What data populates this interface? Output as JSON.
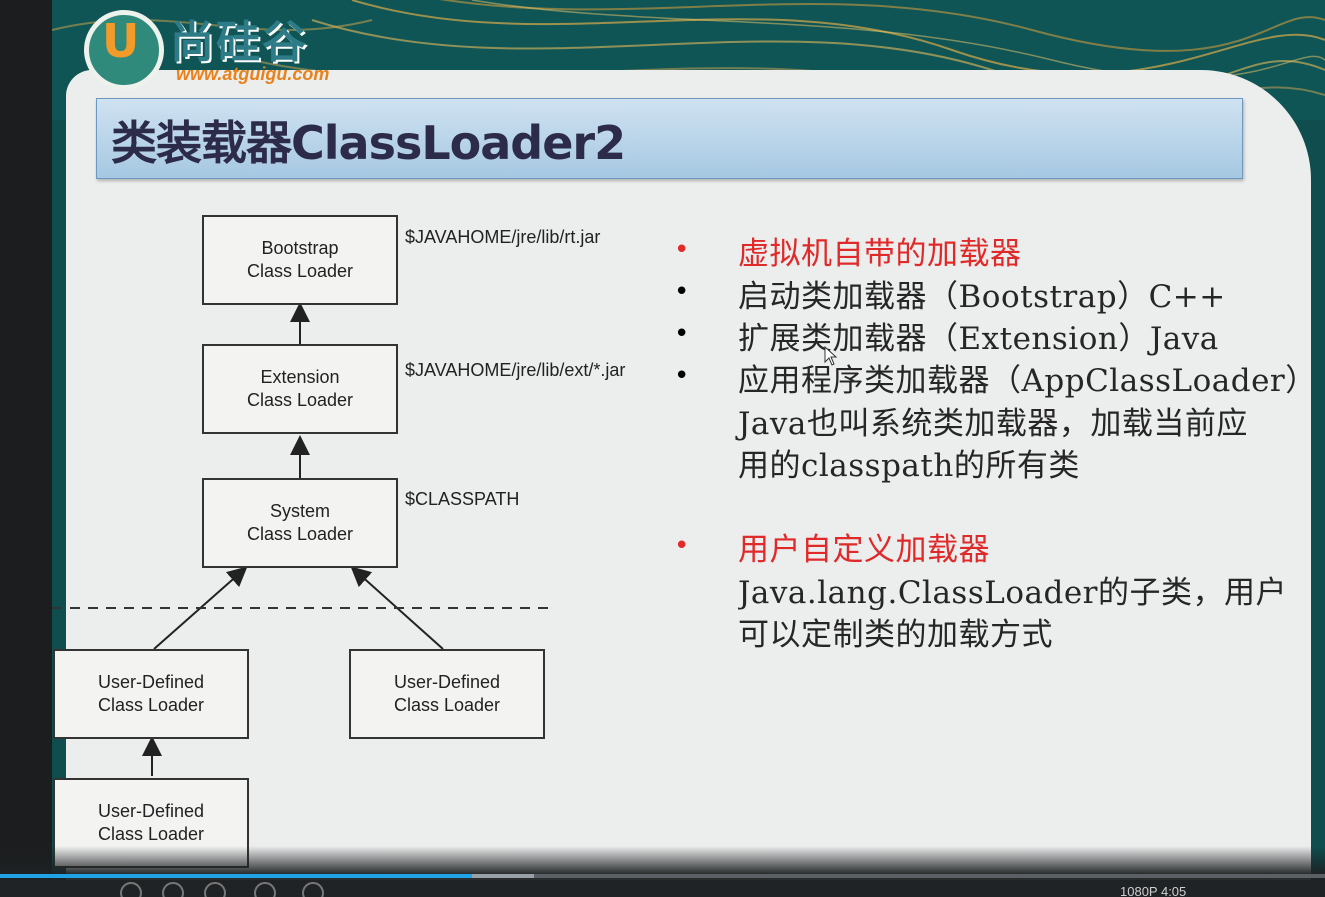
{
  "slide": {
    "logo": {
      "letter": "U",
      "brand": "尚硅谷",
      "url": "www.atguigu.com"
    },
    "title": "类装载器ClassLoader2"
  },
  "diagram": {
    "boxes": [
      {
        "id": "bootstrap",
        "lines": [
          "Bootstrap",
          "Class Loader"
        ]
      },
      {
        "id": "extension",
        "lines": [
          "Extension",
          "Class Loader"
        ]
      },
      {
        "id": "system",
        "lines": [
          "System",
          "Class Loader"
        ]
      },
      {
        "id": "user1",
        "lines": [
          "User-Defined",
          "Class Loader"
        ]
      },
      {
        "id": "user2",
        "lines": [
          "User-Defined",
          "Class Loader"
        ]
      },
      {
        "id": "user3",
        "lines": [
          "User-Defined",
          "Class Loader"
        ]
      }
    ],
    "paths": {
      "bootstrap": "$JAVAHOME/jre/lib/rt.jar",
      "extension": "$JAVAHOME/jre/lib/ext/*.jar",
      "system": "$CLASSPATH"
    }
  },
  "notes": {
    "section1_heading": "虚拟机自带的加载器",
    "item_bootstrap": "启动类加载器（Bootstrap）C++",
    "item_extension": "扩展类加载器（Extension）Java",
    "item_app": "应用程序类加载器（AppClassLoader）",
    "item_app_cont1": "Java也叫系统类加载器，加载当前应",
    "item_app_cont2": "用的classpath的所有类",
    "section2_heading": "用户自定义加载器",
    "section2_line1": "Java.lang.ClassLoader的子类，用户",
    "section2_line2": "可以定制类的加载方式"
  },
  "player": {
    "progress_fraction": 0.356,
    "buffered_fraction": 0.403,
    "time_text": "1080P   4:05"
  },
  "colors": {
    "accent_red": "#e02a2a",
    "progress": "#1fa3e6",
    "title_bar": "#b7d3ea"
  }
}
